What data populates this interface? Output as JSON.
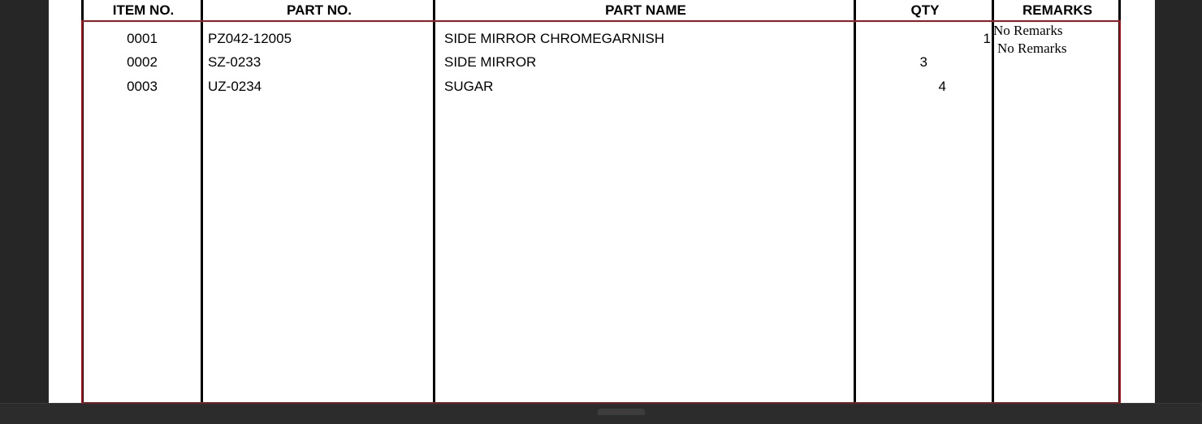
{
  "table": {
    "headers": {
      "item_no": "ITEM NO.",
      "part_no": "PART NO.",
      "part_name": "PART NAME",
      "qty": "QTY",
      "remarks": "REMARKS"
    },
    "rows": [
      {
        "item_no": "0001",
        "part_no": "PZ042-12005",
        "part_name": "SIDE MIRROR CHROMEGARNISH",
        "qty": "1",
        "remarks": "No Remarks"
      },
      {
        "item_no": "0002",
        "part_no": "SZ-0233",
        "part_name": "SIDE MIRROR",
        "qty": "3",
        "remarks": "No Remarks"
      },
      {
        "item_no": "0003",
        "part_no": "UZ-0234",
        "part_name": "SUGAR",
        "qty": "4",
        "remarks": ""
      }
    ]
  },
  "colors": {
    "viewer_background": "#262626",
    "page_background": "#ffffff",
    "selection_outline": "#b0101a",
    "grid_lines": "#000000"
  }
}
